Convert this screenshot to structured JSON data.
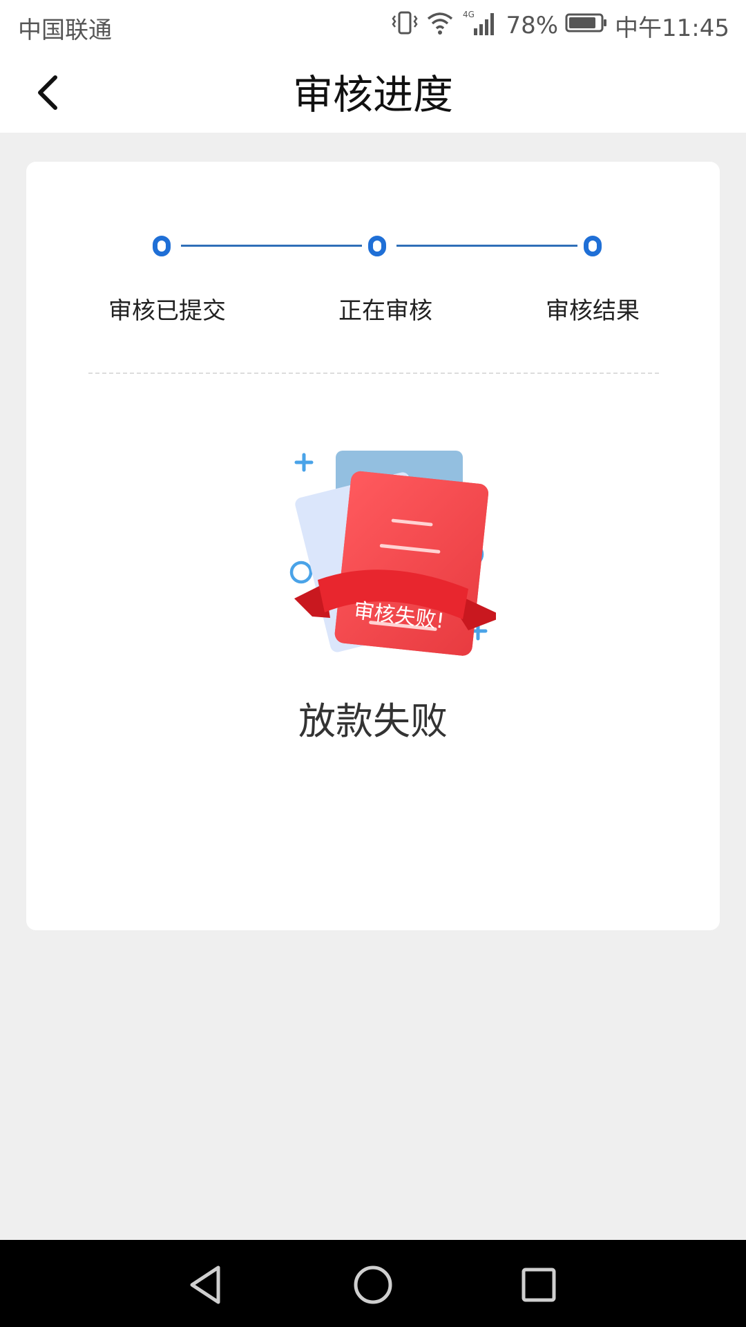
{
  "status_bar": {
    "carrier": "中国联通",
    "network": "4G",
    "battery": "78%",
    "time": "中午11:45",
    "icons": [
      "vibrate-icon",
      "wifi-icon",
      "signal-icon",
      "battery-icon"
    ]
  },
  "header": {
    "title": "审核进度",
    "back_icon": "chevron-left-icon"
  },
  "progress": {
    "steps": [
      {
        "label": "审核已提交"
      },
      {
        "label": "正在审核"
      },
      {
        "label": "审核结果"
      }
    ],
    "accent_color": "#1f6fd6"
  },
  "result": {
    "stamp_text": "审核失败!",
    "message": "放款失败",
    "stamp_color": "#e8353d"
  },
  "nav_bar": {
    "icons": [
      "back-triangle-icon",
      "home-circle-icon",
      "recents-square-icon"
    ]
  }
}
